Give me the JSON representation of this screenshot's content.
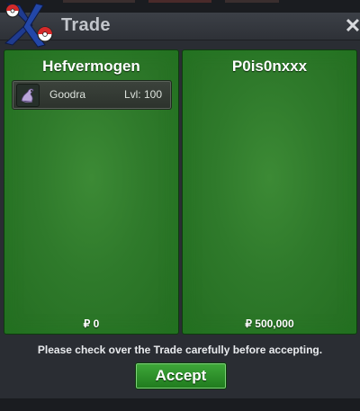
{
  "window": {
    "title": "Trade",
    "close_glyph": "✕",
    "logo_icon": "pokeball-logo-icon"
  },
  "trade": {
    "left": {
      "player": "Hefvermogen",
      "money": "₽ 0",
      "items": [
        {
          "pokemon": "Goodra",
          "level": "Lvl: 100",
          "icon": "goodra-sprite-icon"
        }
      ]
    },
    "right": {
      "player": "P0is0nxxx",
      "money": "₽ 500,000",
      "items": []
    }
  },
  "notice": "Please check over the Trade carefully before accepting.",
  "accept_label": "Accept",
  "colors": {
    "panel_green": "#2f7a2b",
    "accept_green": "#2f9a2c",
    "background": "#2a2d33"
  }
}
